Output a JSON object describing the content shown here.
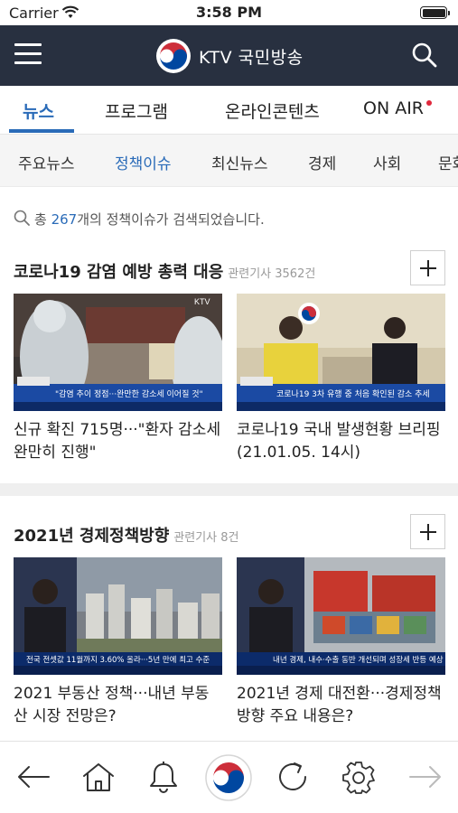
{
  "status": {
    "carrier": "Carrier",
    "time": "3:58 PM"
  },
  "header": {
    "title": "KTV 국민방송"
  },
  "main_tabs": [
    {
      "label": "뉴스"
    },
    {
      "label": "프로그램"
    },
    {
      "label": "온라인콘텐츠"
    },
    {
      "label": "ON AIR"
    }
  ],
  "sub_tabs": [
    {
      "label": "주요뉴스"
    },
    {
      "label": "정책이슈"
    },
    {
      "label": "최신뉴스"
    },
    {
      "label": "경제"
    },
    {
      "label": "사회"
    },
    {
      "label": "문화"
    }
  ],
  "result": {
    "prefix": "총 ",
    "count": "267",
    "suffix": "개의 정책이슈가 검색되었습니다."
  },
  "sections": [
    {
      "title": "코로나19 감염 예방 총력 대응",
      "related": "관련기사 3562건",
      "cards": [
        {
          "caption": "신규 확진 715명···\"환자 감소세 완만히 진행\"",
          "banner": "\"감염 추이 정점···완만한 감소세 이어질 것\"",
          "tag": "KTV"
        },
        {
          "caption": "코로나19 국내 발생현황 브리핑 (21.01.05. 14시)",
          "banner": "코로나19 3차 유행 중 처음 확인된 감소 추세"
        }
      ]
    },
    {
      "title": "2021년 경제정책방향",
      "related": "관련기사 8건",
      "cards": [
        {
          "caption": "2021 부동산 정책···내년 부동산 시장 전망은?",
          "banner": "전국 전셋값 11월까지 3.60% 올라···5년 만에 최고 수준"
        },
        {
          "caption": "2021년 경제 대전환···경제정책방향 주요 내용은?",
          "banner": "내년 경제, 내수·수출 동반 개선되며 성장세 반등 예상"
        }
      ]
    }
  ],
  "colors": {
    "header_bg": "#283040",
    "accent": "#2a6bb8",
    "live_dot": "#e0283c"
  }
}
